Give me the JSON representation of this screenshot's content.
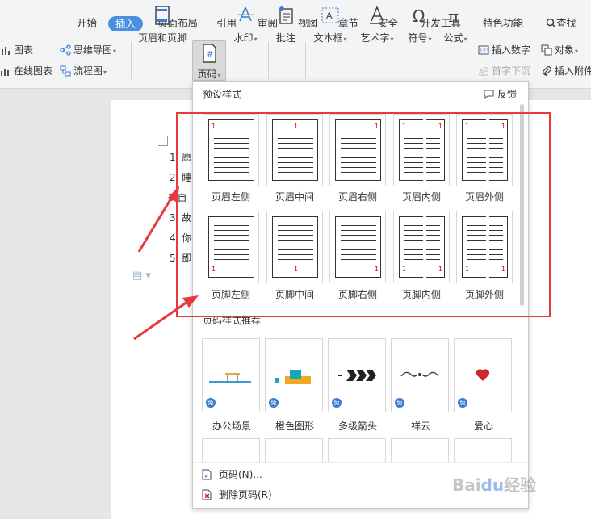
{
  "tabs": [
    "开始",
    "插入",
    "页面布局",
    "引用",
    "审阅",
    "视图",
    "章节",
    "安全",
    "开发工具",
    "特色功能"
  ],
  "active_tab": "插入",
  "search_label": "查找",
  "ribbon": {
    "chart": "图表",
    "online_chart": "在线图表",
    "mindmap": "思维导图",
    "flowchart": "流程图",
    "header_footer": "页眉和页脚",
    "page_number": "页码",
    "watermark": "水印",
    "comment": "批注",
    "textbox": "文本框",
    "wordart": "艺术字",
    "symbol": "符号",
    "formula": "公式",
    "insert_number": "插入数字",
    "object": "对象",
    "dropcap": "首字下沉",
    "attachment": "插入附件"
  },
  "document": {
    "lines": [
      "1. 愿",
      "2. 睡",
      "3.自 ",
      "3. 故",
      "4. 你",
      "5. 即"
    ]
  },
  "panel": {
    "header": "预设样式",
    "feedback": "反馈",
    "presets": [
      "页眉左侧",
      "页眉中间",
      "页眉右侧",
      "页眉内侧",
      "页眉外侧",
      "页脚左侧",
      "页脚中间",
      "页脚右侧",
      "页脚内侧",
      "页脚外侧"
    ],
    "page_num_glyph": "1",
    "recommend_header": "页码样式推荐",
    "recommend": [
      "办公场景",
      "橙色图形",
      "多级箭头",
      "祥云",
      "爱心"
    ],
    "badge": "免",
    "footer": {
      "page_number": "页码(N)...",
      "delete_page_number": "删除页码(R)"
    }
  },
  "watermark": "Baidu经验",
  "colors": {
    "accent": "#4a90e2",
    "annotation_red": "#e8393e"
  }
}
